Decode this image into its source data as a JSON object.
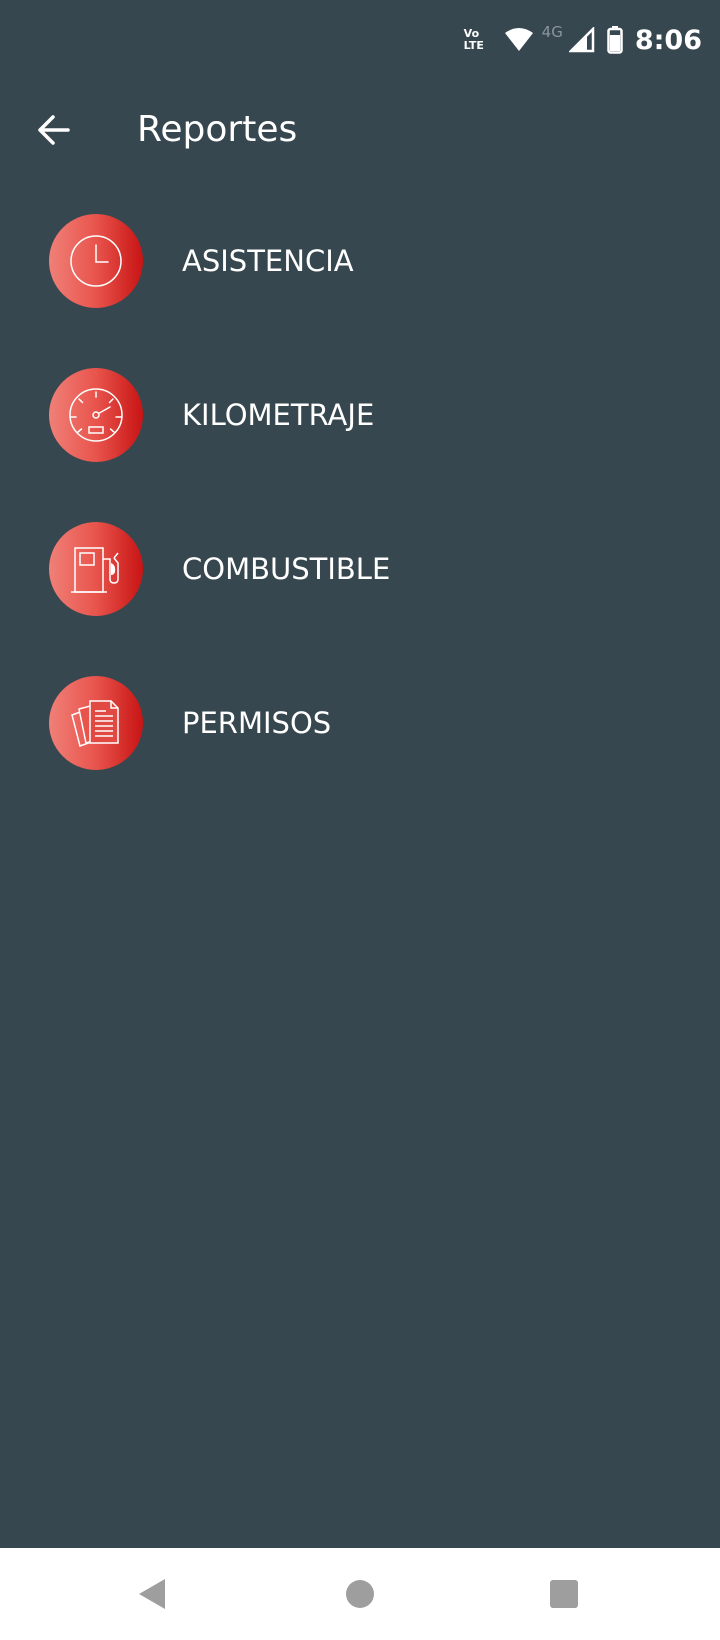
{
  "status_bar": {
    "volte_top": "Vo",
    "volte_bottom": "LTE",
    "network": "4G",
    "time": "8:06",
    "icons": [
      "volte-icon",
      "wifi-icon",
      "signal-icon",
      "battery-icon"
    ]
  },
  "app_bar": {
    "title": "Reportes",
    "back_icon": "arrow-left-icon"
  },
  "menu": {
    "items": [
      {
        "label": "ASISTENCIA",
        "icon": "clock-icon"
      },
      {
        "label": "KILOMETRAJE",
        "icon": "speedometer-icon"
      },
      {
        "label": "COMBUSTIBLE",
        "icon": "fuel-pump-icon"
      },
      {
        "label": "PERMISOS",
        "icon": "documents-icon"
      }
    ]
  },
  "nav_bar": {
    "buttons": [
      "back-triangle-icon",
      "home-circle-icon",
      "recents-square-icon"
    ]
  },
  "colors": {
    "background": "#37474f",
    "icon_gradient_start": "#f08078",
    "icon_gradient_end": "#c81414",
    "text": "#ffffff",
    "nav_background": "#ffffff",
    "nav_icons": "#9e9e9e"
  }
}
